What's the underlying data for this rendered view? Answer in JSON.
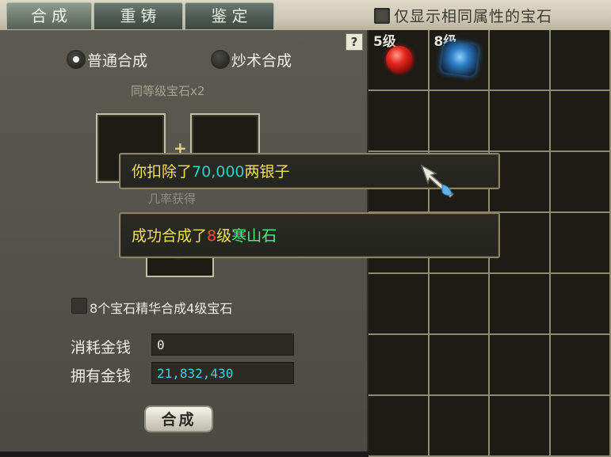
{
  "tabs": [
    {
      "label": "合成",
      "active": true
    },
    {
      "label": "重铸",
      "active": false
    },
    {
      "label": "鉴定",
      "active": false
    }
  ],
  "filter": {
    "label": "仅显示相同属性的宝石",
    "checked": false
  },
  "help": {
    "label": "?"
  },
  "modes": {
    "normal": {
      "label": "普通合成",
      "selected": true
    },
    "magic": {
      "label": "炒术合成",
      "selected": false
    }
  },
  "hint": "同等级宝石x2",
  "plus": "+",
  "prob_label": "几率获得",
  "essence": {
    "label": "8个宝石精华合成4级宝石",
    "checked": false
  },
  "cost": {
    "label": "消耗金钱",
    "value": "0"
  },
  "owned": {
    "label": "拥有金钱",
    "value": "21,832,430"
  },
  "synth_button": "合成",
  "inventory": {
    "items": [
      {
        "level": "5级",
        "gem": "red-gem"
      },
      {
        "level": "8级",
        "gem": "blue-gem"
      }
    ]
  },
  "messages": {
    "msg1": {
      "prefix": "你扣除了",
      "amount": "70,000",
      "suffix": "两银子"
    },
    "msg2": {
      "prefix": "成功合成了",
      "level": "8",
      "mid": "级",
      "item": "寒山石"
    }
  },
  "colors": {
    "yellow": "#f2e14f",
    "cyan": "#36c9c2",
    "red": "#ff4a3c",
    "green": "#4ff07b"
  }
}
